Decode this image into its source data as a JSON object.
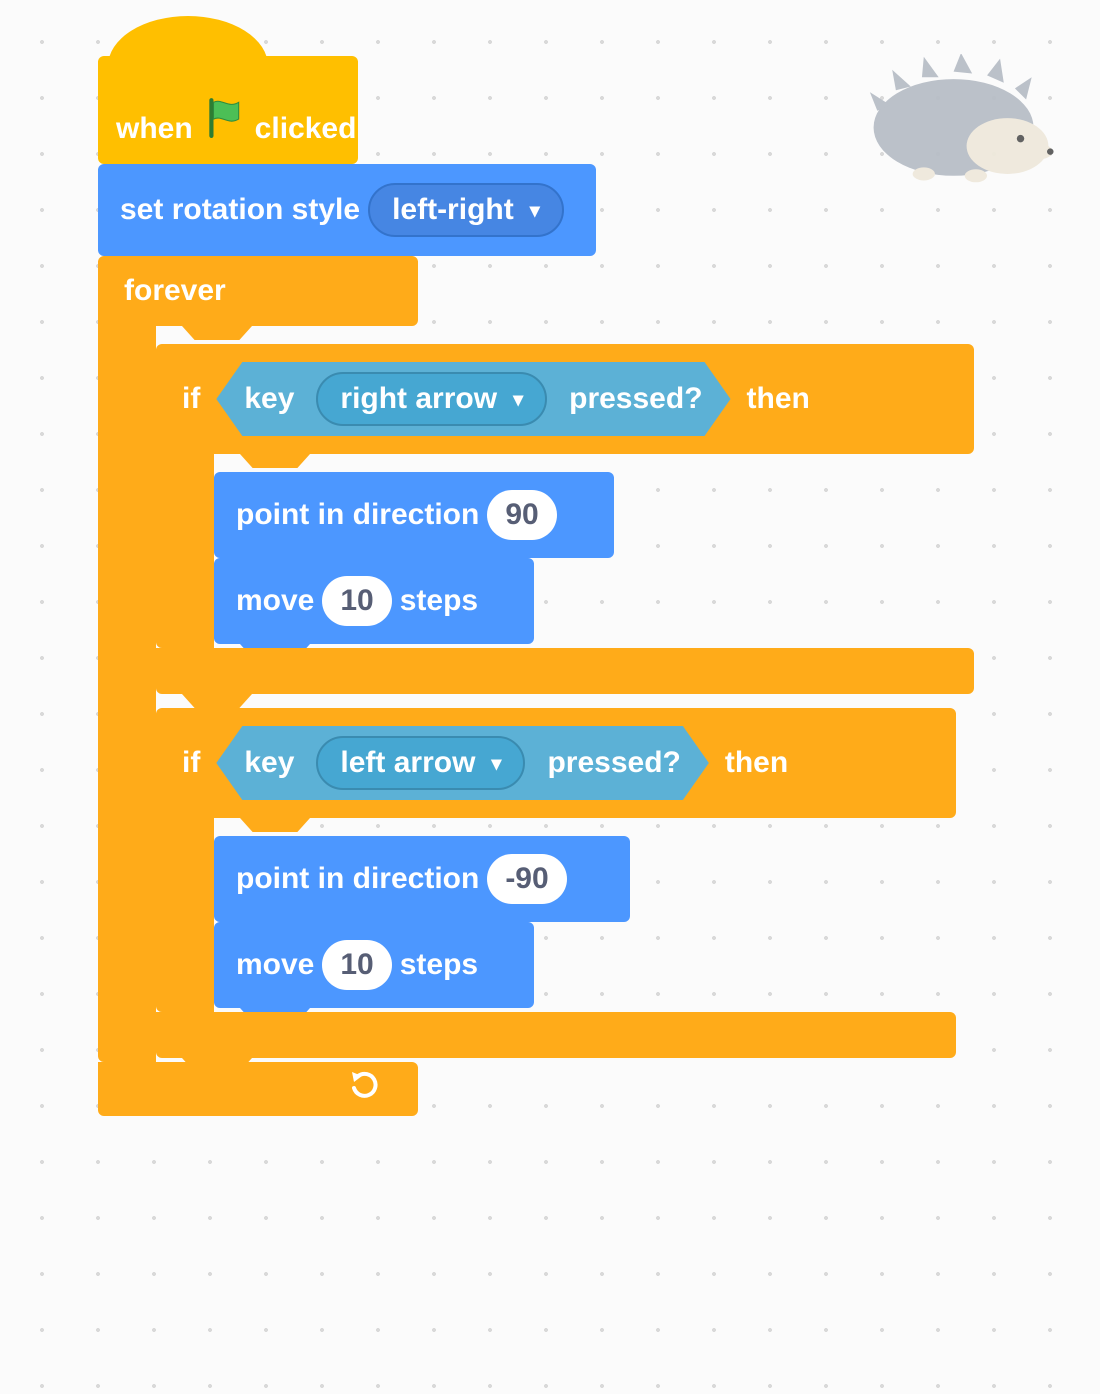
{
  "hat": {
    "when": "when",
    "clicked": "clicked"
  },
  "set_rotation": {
    "label": "set rotation style",
    "option": "left-right"
  },
  "forever": {
    "label": "forever"
  },
  "if1": {
    "if": "if",
    "then": "then",
    "sensing": {
      "key": "key",
      "option": "right arrow",
      "pressed": "pressed?"
    },
    "point": {
      "label": "point in direction",
      "value": "90"
    },
    "move": {
      "prefix": "move",
      "value": "10",
      "suffix": "steps"
    }
  },
  "if2": {
    "if": "if",
    "then": "then",
    "sensing": {
      "key": "key",
      "option": "left arrow",
      "pressed": "pressed?"
    },
    "point": {
      "label": "point in direction",
      "value": "-90"
    },
    "move": {
      "prefix": "move",
      "value": "10",
      "suffix": "steps"
    }
  },
  "icons": {
    "flag": "green-flag-icon",
    "dropdown": "▾",
    "repeat": "↻"
  }
}
